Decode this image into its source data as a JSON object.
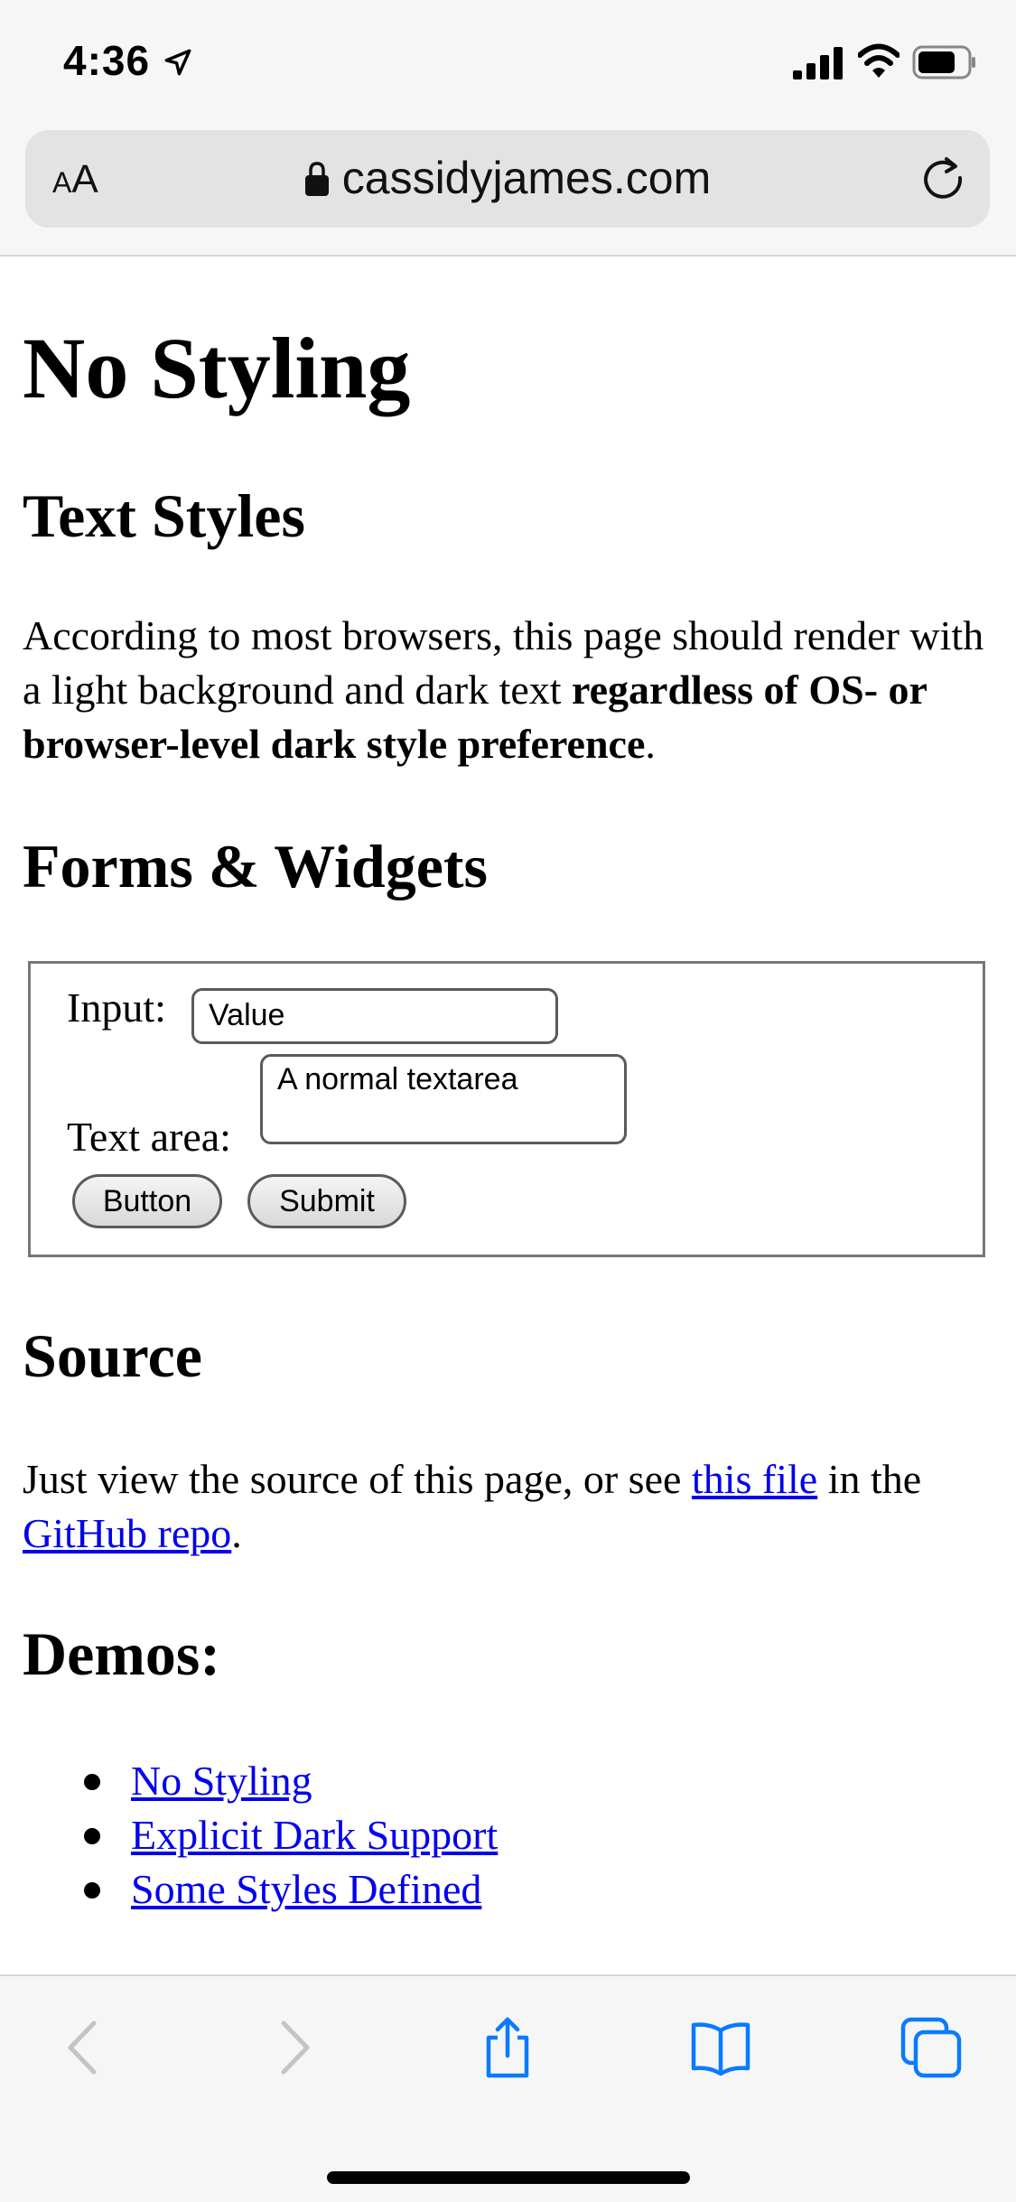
{
  "status": {
    "time": "4:36"
  },
  "browser": {
    "aa_small": "A",
    "aa_large": "A",
    "url": "cassidyjames.com"
  },
  "page": {
    "title": "No Styling",
    "text_styles_heading": "Text Styles",
    "intro_text": "According to most browsers, this page should render with a light background and dark text ",
    "intro_bold": "regardless of OS- or browser-level dark style preference",
    "intro_end": ".",
    "forms_heading": "Forms & Widgets",
    "form": {
      "input_label": "Input:",
      "input_value": "Value",
      "textarea_label": "Text area:",
      "textarea_value": "A normal textarea",
      "button_label": "Button",
      "submit_label": "Submit"
    },
    "source_heading": "Source",
    "source_text_1": "Just view the source of this page, or see ",
    "source_link_1": "this file",
    "source_text_2": " in the ",
    "source_link_2": "GitHub repo",
    "source_text_3": ".",
    "demos_heading": "Demos:",
    "demos": [
      "No Styling",
      "Explicit Dark Support",
      "Some Styles Defined"
    ]
  },
  "colors": {
    "link": "#0000ee",
    "accent": "#0a7aff",
    "disabled": "#c4c4c6"
  },
  "icons": [
    "location-arrow-icon",
    "signal-icon",
    "wifi-icon",
    "battery-icon",
    "lock-icon",
    "reload-icon",
    "back-icon",
    "forward-icon",
    "share-icon",
    "bookmarks-icon",
    "tabs-icon"
  ]
}
